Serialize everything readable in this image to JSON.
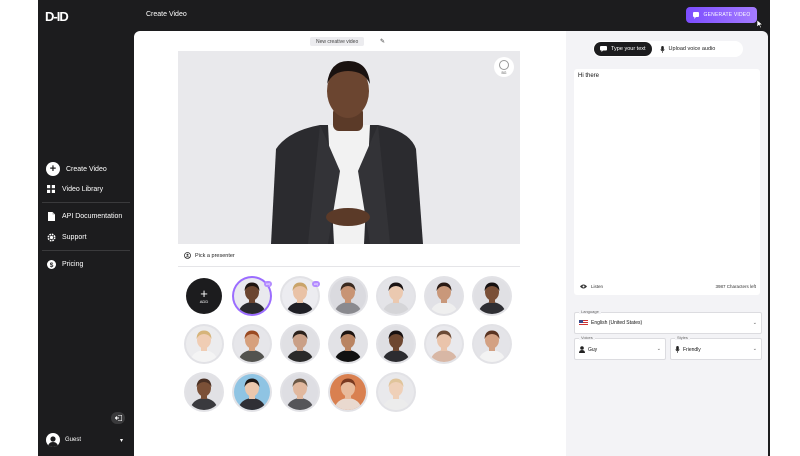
{
  "app": {
    "logo": "D-ID",
    "page_title": "Create Video",
    "generate_label": "GENERATE VIDEO",
    "accent": "#8a5cff"
  },
  "sidebar": {
    "items": [
      {
        "label": "Create Video",
        "icon": "plus-circle-icon"
      },
      {
        "label": "Video Library",
        "icon": "grid-icon"
      },
      {
        "label": "API Documentation",
        "icon": "document-icon"
      },
      {
        "label": "Support",
        "icon": "gear-icon"
      },
      {
        "label": "Pricing",
        "icon": "dollar-icon"
      }
    ],
    "user": "Guest"
  },
  "editor": {
    "video_title": "New creative video",
    "bg_button_label": "BG",
    "pick_label": "Pick a presenter",
    "add_label": "ADD",
    "badge_label": "HQ"
  },
  "presenters": [
    {
      "name": "add",
      "type": "add"
    },
    {
      "name": "man-suit",
      "skin": "#6b4530",
      "hair": "#1d1410",
      "shirt": "#2a2a2e",
      "bg": "#e9e9ee",
      "selected": true,
      "badge": true
    },
    {
      "name": "woman-blonde",
      "skin": "#e9c2a6",
      "hair": "#c9a46a",
      "shirt": "#1f1f25",
      "bg": "#ececf0",
      "badge": true
    },
    {
      "name": "man-beard",
      "skin": "#c89474",
      "hair": "#3a2a20",
      "shirt": "#8a8a8f",
      "bg": "#dadadf"
    },
    {
      "name": "woman-asian",
      "skin": "#ebc9b0",
      "hair": "#1b1414",
      "shirt": "#d5d5d8",
      "bg": "#e4e4e8"
    },
    {
      "name": "woman-long-hair",
      "skin": "#c9987a",
      "hair": "#2a1a14",
      "shirt": "#efefef",
      "bg": "#e1e1e6"
    },
    {
      "name": "man-glasses",
      "skin": "#7a5038",
      "hair": "#151010",
      "shirt": "#2e2e33",
      "bg": "#e0e0e4"
    },
    {
      "name": "woman-blonde-2",
      "skin": "#f0cdb4",
      "hair": "#d6b47a",
      "shirt": "#f4f4f4",
      "bg": "#ececee"
    },
    {
      "name": "man-red-beard",
      "skin": "#d6a07d",
      "hair": "#9a4a22",
      "shirt": "#53534f",
      "bg": "#e6e6ea"
    },
    {
      "name": "man-short-hair",
      "skin": "#caa087",
      "hair": "#2b211b",
      "shirt": "#2a2a2a",
      "bg": "#e0e0e4"
    },
    {
      "name": "man-black-shirt",
      "skin": "#b98462",
      "hair": "#1d1410",
      "shirt": "#111111",
      "bg": "#e2e2e6"
    },
    {
      "name": "man-curly",
      "skin": "#6e4730",
      "hair": "#171010",
      "shirt": "#2c2c30",
      "bg": "#dfdfe3"
    },
    {
      "name": "woman-ponytail",
      "skin": "#eac4ab",
      "hair": "#6b4a35",
      "shirt": "#d8b7a5",
      "bg": "#e9e9ed"
    },
    {
      "name": "woman-curly",
      "skin": "#d3a183",
      "hair": "#5a3422",
      "shirt": "#f3f3f3",
      "bg": "#e4e4e8"
    },
    {
      "name": "man-bald",
      "skin": "#7b5037",
      "hair": "#4a3024",
      "shirt": "#3a3a3e",
      "bg": "#e1e1e5"
    },
    {
      "name": "man-asian-blue",
      "skin": "#eac7ad",
      "hair": "#1e1816",
      "shirt": "#2f2f35",
      "bg": "#8fc4e3"
    },
    {
      "name": "man-glasses-2",
      "skin": "#e1b89e",
      "hair": "#6b5846",
      "shirt": "#555559",
      "bg": "#dedee3"
    },
    {
      "name": "woman-orange",
      "skin": "#e8bb9c",
      "hair": "#7a3a20",
      "shirt": "#e9d9cf",
      "bg": "#d98050"
    },
    {
      "name": "woman-blonde-3",
      "skin": "#efd0b8",
      "hair": "#e0c49a",
      "shirt": "#ececec",
      "bg": "#e9e9ec"
    }
  ],
  "panel": {
    "tab_text": "Type your text",
    "tab_audio": "Upload voice audio",
    "script": "Hi there",
    "listen": "Listen",
    "chars_left": "3987 Characters left",
    "language_label": "Language",
    "language_value": "English (United States)",
    "voices_label": "Voices",
    "voice_value": "Guy",
    "styles_label": "Styles",
    "style_value": "Friendly"
  }
}
